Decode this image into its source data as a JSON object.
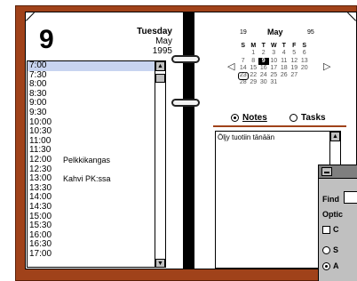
{
  "planner": {
    "day_number": "9",
    "weekday": "Tuesday",
    "month": "May",
    "year": "1995"
  },
  "schedule": {
    "times": [
      "7:00",
      "7:30",
      "8:00",
      "8:30",
      "9:00",
      "9:30",
      "10:00",
      "10:30",
      "11:00",
      "11:30",
      "12:00",
      "12:30",
      "13:00",
      "13:30",
      "14:00",
      "14:30",
      "15:00",
      "15:30",
      "16:00",
      "16:30",
      "17:00"
    ],
    "appointments": [
      {
        "time": "12:00",
        "text": "Pelkkikangas"
      },
      {
        "time": "13:00",
        "text": "Kahvi PK:ssa"
      }
    ]
  },
  "calendar": {
    "week": "19",
    "month": "May",
    "year_short": "95",
    "day_headers": [
      "S",
      "M",
      "T",
      "W",
      "T",
      "F",
      "S"
    ],
    "weeks": [
      [
        "",
        "1",
        "2",
        "3",
        "4",
        "5",
        "6"
      ],
      [
        "7",
        "8",
        "9",
        "10",
        "11",
        "12",
        "13"
      ],
      [
        "14",
        "15",
        "16",
        "17",
        "18",
        "19",
        "20"
      ],
      [
        "21",
        "22",
        "23",
        "24",
        "25",
        "26",
        "27"
      ],
      [
        "28",
        "29",
        "30",
        "31",
        "",
        "",
        ""
      ]
    ],
    "prev": "◁",
    "next": "▷"
  },
  "view": {
    "notes_label": "Notes",
    "tasks_label": "Tasks",
    "note_text": "Öljy tuotiin tänään"
  },
  "find_dialog": {
    "find_label": "Find",
    "options_label": "Optic",
    "opt1": "C",
    "opt2": "S",
    "opt3": "A"
  },
  "icons": {
    "scroll_up": "▲",
    "scroll_down": "▼"
  }
}
